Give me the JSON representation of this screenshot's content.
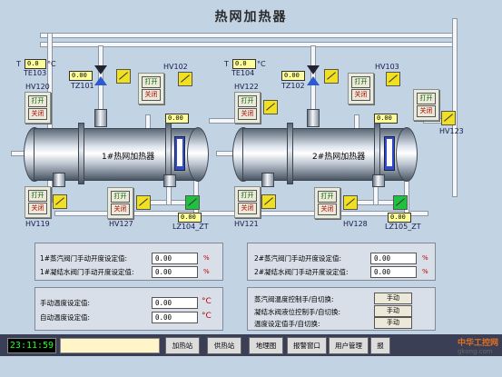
{
  "title": "热网加热器",
  "units": {
    "temp": "°C",
    "pct": "%"
  },
  "heater1": {
    "name": "1#热网加热器",
    "te": "TE103",
    "te_val": "0.0",
    "hv_left_top": "HV120",
    "hv_left_bot": "HV119",
    "valve_val": "0.00",
    "tz": "TZ101",
    "hv_top": "HV102",
    "hv_top_val": "0.00",
    "hv_bot": "HV127",
    "lz": "LZ104_ZT",
    "lz_val": "0.00",
    "vessel_val": "0.00"
  },
  "heater2": {
    "name": "2#热网加热器",
    "te": "TE104",
    "te_val": "0.0",
    "hv_left_top": "HV122",
    "hv_left_bot": "HV121",
    "valve_val": "0.00",
    "tz": "TZ102",
    "hv_top": "HV103",
    "hv_right": "HV123",
    "hv_bot": "HV128",
    "lz": "LZ105_ZT",
    "lz_val": "0.00",
    "vessel_val": "0.00"
  },
  "buttons": {
    "open": "打开",
    "close": "关闭",
    "manual": "手动"
  },
  "settings1": [
    {
      "label": "1#蒸汽阀门手动开度设定值:",
      "value": "0.00"
    },
    {
      "label": "1#凝结水阀门手动开度设定值:",
      "value": "0.00"
    }
  ],
  "settings2": [
    {
      "label": "2#蒸汽阀门手动开度设定值:",
      "value": "0.00"
    },
    {
      "label": "2#凝结水阀门手动开度设定值:",
      "value": "0.00"
    }
  ],
  "temp_settings": [
    {
      "label": "手动温度设定值:",
      "value": "0.00"
    },
    {
      "label": "自动温度设定值:",
      "value": "0.00"
    }
  ],
  "mode_switches": [
    {
      "label": "蒸汽阀温度控制手/自切换:",
      "state": "手动"
    },
    {
      "label": "凝结水阀液位控制手/自切换:",
      "state": "手动"
    },
    {
      "label": "温度设定值手/自切换:",
      "state": "手动"
    }
  ],
  "statusbar": {
    "clock": "23:11:59",
    "nav": [
      "加热站",
      "供热站",
      "地理图",
      "报警窗口",
      "用户管理",
      "报"
    ]
  },
  "watermark": {
    "brand": "中华工控网",
    "url": "gkong.com"
  },
  "colors": {
    "bg": "#c2d3e4",
    "indicator": "#f0e020",
    "value": "#ffff9a",
    "clock": "#22ff22"
  }
}
